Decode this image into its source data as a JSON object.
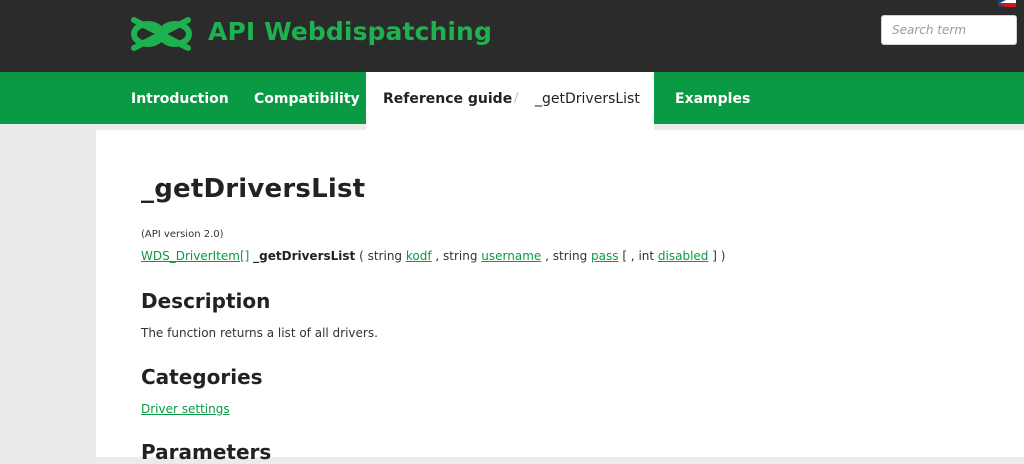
{
  "header": {
    "brand": "API Webdispatching",
    "search_placeholder": "Search term",
    "logo_icon": "link-logo-icon",
    "language_icon": "czech-flag-icon"
  },
  "nav": {
    "introduction": "Introduction",
    "compatibility": "Compatibility",
    "reference_guide": "Reference guide",
    "separator": "/",
    "current_page": "_getDriversList",
    "examples": "Examples"
  },
  "page": {
    "title": "_getDriversList",
    "api_version": "(API version 2.0)",
    "signature": {
      "return_type": "WDS_DriverItem[]",
      "function_name": "_getDriversList",
      "p_open": " ( string ",
      "param1": "kodf",
      "c1": " , string ",
      "param2": "username",
      "c2": " , string ",
      "param3": "pass",
      "c3": " [ , int ",
      "param4": "disabled",
      "p_close": " ] )"
    },
    "description_heading": "Description",
    "description_text": "The function returns a list of all drivers.",
    "categories_heading": "Categories",
    "category_link": "Driver settings",
    "parameters_heading": "Parameters"
  },
  "colors": {
    "header_bg": "#2b2b2b",
    "brand_green": "#1db24f",
    "nav_green": "#0a9a43",
    "page_bg": "#ebebeb"
  }
}
